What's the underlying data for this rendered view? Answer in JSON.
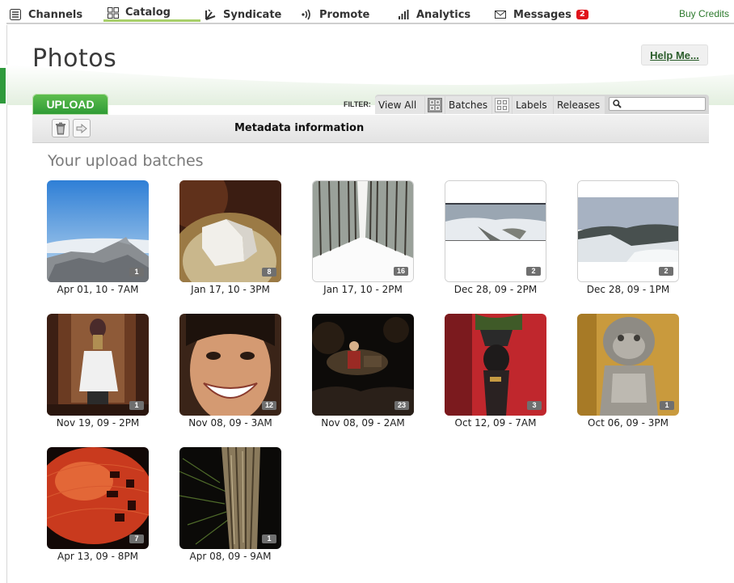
{
  "nav": {
    "items": [
      {
        "label": "Channels",
        "icon": "list-icon"
      },
      {
        "label": "Catalog",
        "icon": "grid-icon"
      },
      {
        "label": "Syndicate",
        "icon": "burst-icon"
      },
      {
        "label": "Promote",
        "icon": "broadcast-icon"
      },
      {
        "label": "Analytics",
        "icon": "bar-chart-icon"
      },
      {
        "label": "Messages",
        "icon": "envelope-icon",
        "badge": "2"
      }
    ],
    "active": "Catalog",
    "buy_credits": "Buy Credits"
  },
  "page": {
    "title": "Photos",
    "help": "Help Me..."
  },
  "upload_label": "UPLOAD",
  "filter": {
    "label": "FILTER:",
    "view_all": "View All",
    "batches": "Batches",
    "labels": "Labels",
    "releases": "Releases",
    "search_placeholder": ""
  },
  "toolbar": {
    "delete_icon": "trash-icon",
    "move_icon": "arrow-right-icon",
    "title": "Metadata information"
  },
  "section_title": "Your upload batches",
  "batches": [
    {
      "date": "Apr 01, 10 - 7AM",
      "count": "1",
      "scene": "mountain-sky"
    },
    {
      "date": "Jan 17, 10 - 3PM",
      "count": "8",
      "scene": "sugar-cube-plate"
    },
    {
      "date": "Jan 17, 10 - 2PM",
      "count": "16",
      "scene": "snowy-tree-avenue"
    },
    {
      "date": "Dec 28, 09 - 2PM",
      "count": "2",
      "scene": "snowy-valley-pano"
    },
    {
      "date": "Dec 28, 09 - 1PM",
      "count": "2",
      "scene": "snowy-mountains-pano"
    },
    {
      "date": "Nov 19, 09 - 2PM",
      "count": "1",
      "scene": "woman-in-doorway"
    },
    {
      "date": "Nov 08, 09 - 3AM",
      "count": "12",
      "scene": "smiling-face"
    },
    {
      "date": "Nov 08, 09 - 2AM",
      "count": "23",
      "scene": "night-concert"
    },
    {
      "date": "Oct 12, 09 - 7AM",
      "count": "3",
      "scene": "statue-red-wall"
    },
    {
      "date": "Oct 06, 09 - 3PM",
      "count": "1",
      "scene": "stone-lion"
    },
    {
      "date": "Apr 13, 09 - 8PM",
      "count": "7",
      "scene": "red-lantern"
    },
    {
      "date": "Apr 08, 09 - 9AM",
      "count": "1",
      "scene": "tree-bark-night"
    }
  ]
}
